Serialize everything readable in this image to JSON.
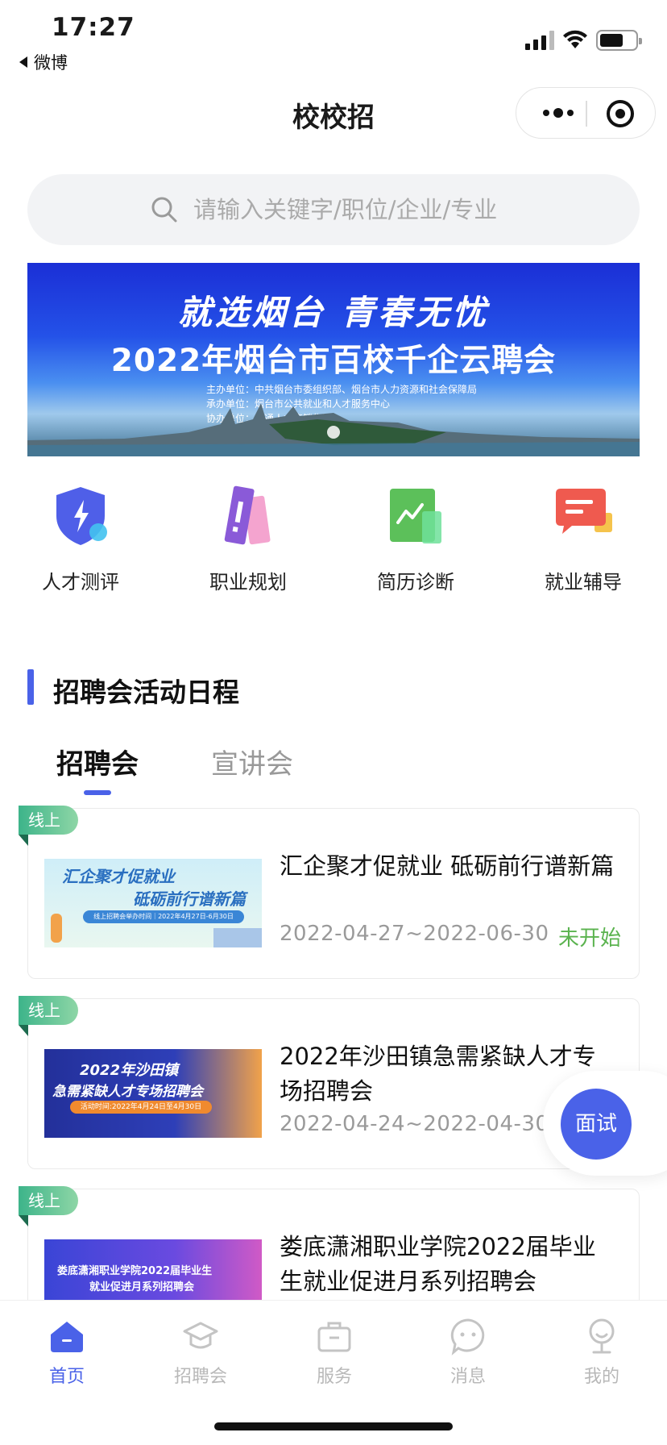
{
  "status_bar": {
    "time": "17:27",
    "back_app": "微博"
  },
  "nav": {
    "title": "校校招"
  },
  "search": {
    "placeholder": "请输入关键字/职位/企业/专业"
  },
  "banner": {
    "slogan": "就选烟台 青春无忧",
    "headline": "2022年烟台市百校千企云聘会",
    "org_lines": [
      "主办单位：中共烟台市委组织部、烟台市人力资源和社会保障局",
      "承办单位：烟台市公共就业和人才服务中心",
      "协办单位：智通人才连锁集团"
    ]
  },
  "quick_entries": [
    {
      "label": "人才测评",
      "icon": "shield-bolt-icon",
      "color": "#4f5fe8"
    },
    {
      "label": "职业规划",
      "icon": "career-plan-icon",
      "color": "#8a5ad8"
    },
    {
      "label": "简历诊断",
      "icon": "resume-chart-icon",
      "color": "#5cc05a"
    },
    {
      "label": "就业辅导",
      "icon": "chat-guide-icon",
      "color": "#ef5a4f"
    }
  ],
  "section": {
    "title": "招聘会活动日程"
  },
  "tabs": [
    {
      "label": "招聘会",
      "active": true
    },
    {
      "label": "宣讲会",
      "active": false
    }
  ],
  "cards": [
    {
      "tag": "线上",
      "title": "汇企聚才促就业 砥砺前行谱新篇",
      "date": "2022-04-27~2022-06-30",
      "status": "未开始",
      "thumb": {
        "line1": "汇企聚才促就业",
        "line2": "砥砺前行谱新篇",
        "line3": "线上招聘会举办时间｜2022年4月27日-6月30日"
      }
    },
    {
      "tag": "线上",
      "title": "2022年沙田镇急需紧缺人才专场招聘会",
      "date": "2022-04-24~2022-04-30",
      "status": "",
      "thumb": {
        "line1": "2022年沙田镇",
        "line2": "急需紧缺人才专场招聘会",
        "line3": "活动时间:2022年4月24日至4月30日"
      }
    },
    {
      "tag": "线上",
      "title": "娄底潇湘职业学院2022届毕业生就业促进月系列招聘会",
      "date": "",
      "status": "",
      "thumb": {
        "line1": "娄底潇湘职业学院2022届毕业生",
        "line2": "就业促进月系列招聘会",
        "line3": ""
      }
    }
  ],
  "float_button": {
    "label": "面试"
  },
  "tabbar": [
    {
      "label": "首页",
      "icon": "home-icon",
      "active": true
    },
    {
      "label": "招聘会",
      "icon": "graduation-cap-icon",
      "active": false
    },
    {
      "label": "服务",
      "icon": "briefcase-icon",
      "active": false
    },
    {
      "label": "消息",
      "icon": "message-bubble-icon",
      "active": false
    },
    {
      "label": "我的",
      "icon": "user-icon",
      "active": false
    }
  ],
  "colors": {
    "accent": "#4a62e8",
    "status_pending": "#5bb34f",
    "tag_green": "#3db48a"
  }
}
